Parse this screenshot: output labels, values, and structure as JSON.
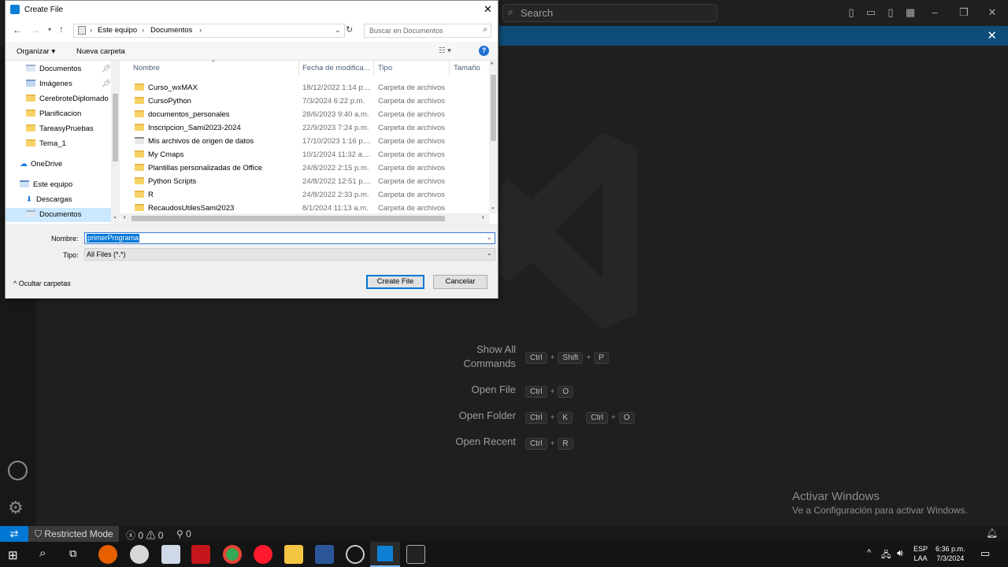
{
  "vscode": {
    "search_placeholder": "Search",
    "shortcuts": [
      {
        "label": "Show All Commands",
        "keys": [
          "Ctrl",
          "Shift",
          "P"
        ]
      },
      {
        "label": "Open File",
        "keys": [
          "Ctrl",
          "O"
        ]
      },
      {
        "label": "Open Folder",
        "keys": [
          "Ctrl",
          "K",
          "Ctrl",
          "O"
        ]
      },
      {
        "label": "Open Recent",
        "keys": [
          "Ctrl",
          "R"
        ]
      }
    ],
    "show_all_line1": "Show All",
    "show_all_line2": "Commands",
    "status": {
      "restricted": "Restricted Mode",
      "errors": "0",
      "warnings": "0",
      "ports": "0"
    },
    "watermark_title": "Activar Windows",
    "watermark_sub": "Ve a Configuración para activar Windows."
  },
  "taskbar": {
    "lang": "ESP",
    "region": "LAA",
    "time": "6:36 p.m.",
    "date": "7/3/2024"
  },
  "dialog": {
    "title": "Create File",
    "breadcrumb": [
      "Este equipo",
      "Documentos"
    ],
    "search_placeholder": "Buscar en Documentos",
    "organizar": "Organizar",
    "nueva_carpeta": "Nueva carpeta",
    "tree": [
      {
        "label": "Documentos",
        "icon": "documents-icon",
        "pinned": true
      },
      {
        "label": "Imágenes",
        "icon": "pictures-icon",
        "pinned": true
      },
      {
        "label": "CerebroteDiplomado",
        "icon": "folder-icon"
      },
      {
        "label": "Planificacion",
        "icon": "folder-icon"
      },
      {
        "label": "TareasyPruebas",
        "icon": "folder-icon"
      },
      {
        "label": "Tema_1",
        "icon": "folder-icon"
      },
      {
        "label": "OneDrive",
        "icon": "cloud-icon"
      },
      {
        "label": "Este equipo",
        "icon": "computer-icon"
      },
      {
        "label": "Descargas",
        "icon": "download-icon"
      },
      {
        "label": "Documentos",
        "icon": "documents-icon",
        "selected": true
      }
    ],
    "columns": {
      "name": "Nombre",
      "date": "Fecha de modifica...",
      "type": "Tipo",
      "size": "Tamaño"
    },
    "files": [
      {
        "name": "Curso_wxMAX",
        "date": "18/12/2022 1:14 p....",
        "type": "Carpeta de archivos"
      },
      {
        "name": "CursoPython",
        "date": "7/3/2024 6:22 p.m.",
        "type": "Carpeta de archivos"
      },
      {
        "name": "documentos_personales",
        "date": "28/6/2023 9:40 a.m.",
        "type": "Carpeta de archivos"
      },
      {
        "name": "Inscripcion_Sami2023-2024",
        "date": "22/9/2023 7:24 p.m.",
        "type": "Carpeta de archivos"
      },
      {
        "name": "Mis archivos de origen de datos",
        "date": "17/10/2023 1:16 p....",
        "type": "Carpeta de archivos"
      },
      {
        "name": "My Cmaps",
        "date": "10/1/2024 11:32 a....",
        "type": "Carpeta de archivos"
      },
      {
        "name": "Plantillas personalizadas de Office",
        "date": "24/8/2022 2:15 p.m.",
        "type": "Carpeta de archivos"
      },
      {
        "name": "Python Scripts",
        "date": "24/8/2022 12:51 p....",
        "type": "Carpeta de archivos"
      },
      {
        "name": "R",
        "date": "24/8/2022 2:33 p.m.",
        "type": "Carpeta de archivos"
      },
      {
        "name": "RecaudosUtilesSami2023",
        "date": "8/1/2024 11:13 a.m.",
        "type": "Carpeta de archivos"
      }
    ],
    "nombre_label": "Nombre:",
    "nombre_value": "primerPrograma",
    "tipo_label": "Tipo:",
    "tipo_value": "All Files (*.*)",
    "ocultar": "Ocultar carpetas",
    "create_btn": "Create File",
    "cancel_btn": "Cancelar"
  }
}
